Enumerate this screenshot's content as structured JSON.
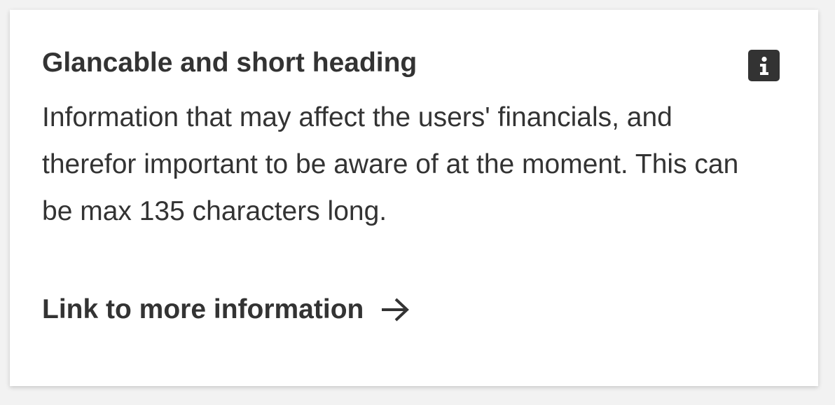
{
  "card": {
    "heading": "Glancable and short heading",
    "info_icon": "info-icon",
    "body": "Information that may affect the users' financials, and therefor important to be aware of at the moment. This can be max 135 characters long.",
    "link": {
      "label": "Link to more information",
      "icon": "arrow-right-icon"
    }
  },
  "colors": {
    "page_background": "#f2f2f2",
    "card_background": "#ffffff",
    "text": "#333333",
    "icon_background": "#333333",
    "icon_foreground": "#ffffff"
  }
}
